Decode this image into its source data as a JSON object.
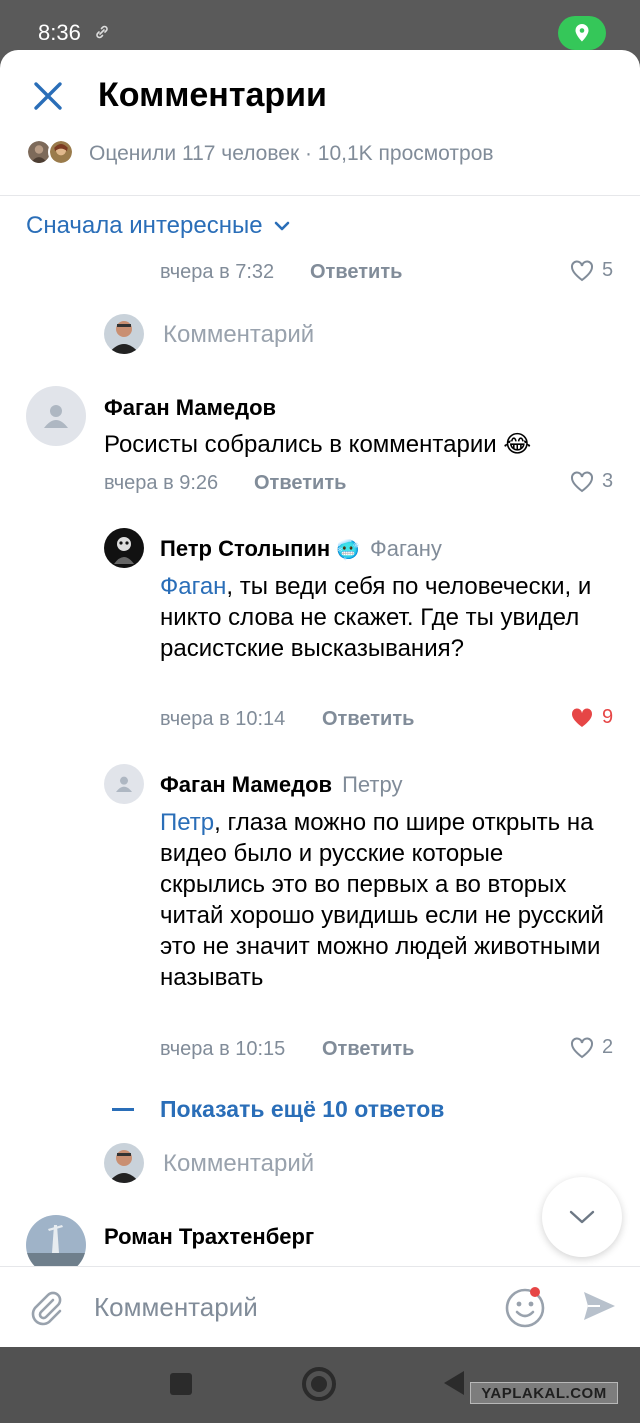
{
  "status_bar": {
    "time": "8:36"
  },
  "header": {
    "title": "Комментарии",
    "rated_text": "Оценили 117 человек · 10,1K просмотров"
  },
  "sort": {
    "label": "Сначала интересные"
  },
  "comments": [
    {
      "time": "вчера в 7:32",
      "reply": "Ответить",
      "likes": "5"
    },
    {
      "name": "Фаган Мамедов",
      "text": "Росисты собрались в комментарии 😂",
      "time": "вчера в 9:26",
      "reply": "Ответить",
      "likes": "3"
    },
    {
      "name": "Петр Столыпин",
      "badge": "🥶",
      "reply_to": "Фагану",
      "mention": "Фаган",
      "text": ", ты веди себя по человечески, и никто слова не скажет. Где ты увидел расистские высказывания?",
      "time": "вчера в 10:14",
      "reply": "Ответить",
      "likes": "9"
    },
    {
      "name": "Фаган Мамедов",
      "reply_to": "Петру",
      "mention": "Петр",
      "text": ", глаза можно по шире открыть на видео было и русские которые скрылись это во первых а во вторых читай хорошо увидишь если не русский это не значит можно людей животными называть",
      "time": "вчера в 10:15",
      "reply": "Ответить",
      "likes": "2"
    },
    {
      "name": "Роман Трахтенберг"
    }
  ],
  "inline_comment_placeholder": "Комментарий",
  "show_more": "Показать ещё 10 ответов",
  "composer": {
    "placeholder": "Комментарий"
  },
  "watermark": "YAPLAKAL.COM",
  "colors": {
    "accent": "#2a6eb8",
    "secondary": "#818c99",
    "liked": "#e64646"
  }
}
